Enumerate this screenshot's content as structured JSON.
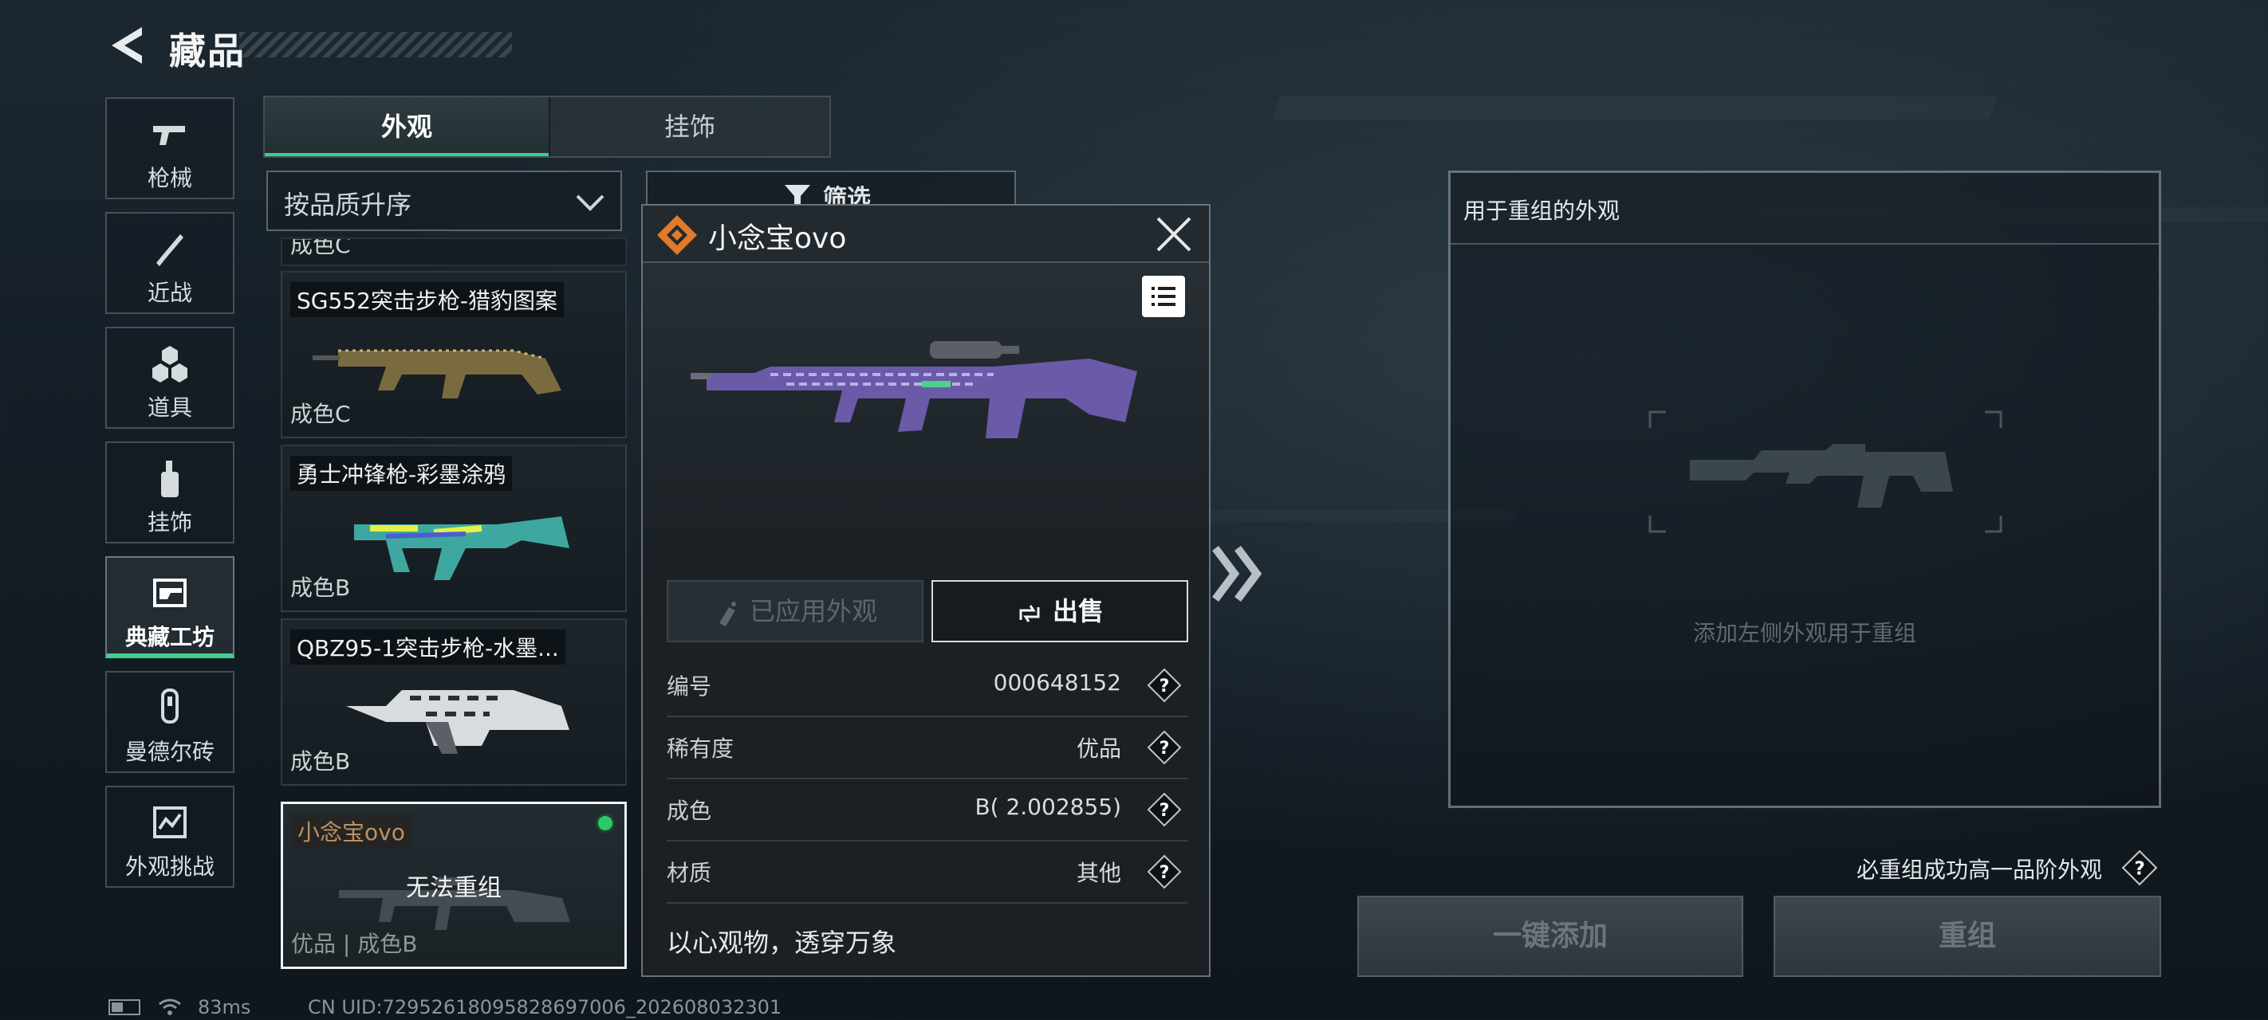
{
  "header": {
    "title": "藏品"
  },
  "nav": [
    {
      "label": "枪械",
      "icon": "pistol-icon"
    },
    {
      "label": "近战",
      "icon": "knife-icon"
    },
    {
      "label": "道具",
      "icon": "grenade-icon"
    },
    {
      "label": "挂饰",
      "icon": "charm-icon"
    },
    {
      "label": "典藏工坊",
      "icon": "workshop-icon",
      "active": true
    },
    {
      "label": "曼德尔砖",
      "icon": "mandel-brick-icon"
    },
    {
      "label": "外观挑战",
      "icon": "challenge-icon"
    }
  ],
  "tabs": {
    "appearance": "外观",
    "charm": "挂饰"
  },
  "sort": {
    "label": "按品质升序"
  },
  "filter": {
    "label": "筛选"
  },
  "list": {
    "clipped_top": "成色C",
    "items": [
      {
        "name": "SG552突击步枪-猎豹图案",
        "condition": "成色C"
      },
      {
        "name": "勇士冲锋枪-彩墨涂鸦",
        "condition": "成色B"
      },
      {
        "name": "QBZ95-1突击步枪-水墨...",
        "condition": "成色B"
      },
      {
        "name": "小念宝ovo",
        "condition": "优品 | 成色B",
        "overlay": "无法重组",
        "selected": true
      }
    ]
  },
  "popup": {
    "name": "小念宝ovo",
    "applied_label": "已应用外观",
    "sell_label": "出售",
    "props": [
      {
        "key": "编号",
        "value": "000648152"
      },
      {
        "key": "稀有度",
        "value": "优品"
      },
      {
        "key": "成色",
        "value": "B( 2.002855)"
      },
      {
        "key": "材质",
        "value": "其他"
      }
    ],
    "description": "以心观物，透穿万象"
  },
  "reassemble": {
    "title": "用于重组的外观",
    "hint": "添加左侧外观用于重组",
    "upgrade_label": "必重组成功高一品阶外观",
    "add_all": "一键添加",
    "reassemble": "重组"
  },
  "status": {
    "ping": "83ms",
    "uid": "CN UID:7295261809582869​7006_202608032301"
  },
  "colors": {
    "accent": "#3fcf8e",
    "badge": "#e07a2a",
    "selected_dot": "#2ec86e"
  }
}
